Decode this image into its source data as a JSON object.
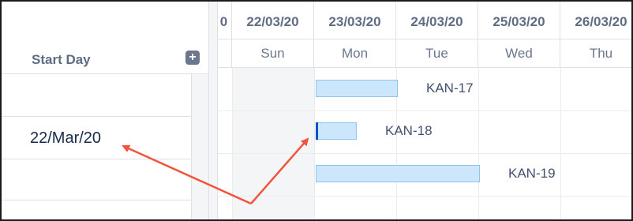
{
  "left_panel": {
    "column_title": "Start Day",
    "add_label": "+",
    "rows": [
      {
        "start_day": ""
      },
      {
        "start_day": "22/Mar/20"
      },
      {
        "start_day": ""
      },
      {
        "start_day": ""
      }
    ]
  },
  "timeline": {
    "partial_date": "0",
    "dates": [
      "22/03/20",
      "23/03/20",
      "24/03/20",
      "25/03/20",
      "26/03/20"
    ],
    "days": [
      "Sun",
      "Mon",
      "Tue",
      "Wed",
      "Thu"
    ]
  },
  "tasks": [
    {
      "key": "KAN-17"
    },
    {
      "key": "KAN-18"
    },
    {
      "key": "KAN-19"
    }
  ],
  "colors": {
    "bar_fill": "#cce7fb",
    "bar_border": "#8cc6ee",
    "arrow": "#f4533b",
    "header_text": "#5e6c84"
  }
}
